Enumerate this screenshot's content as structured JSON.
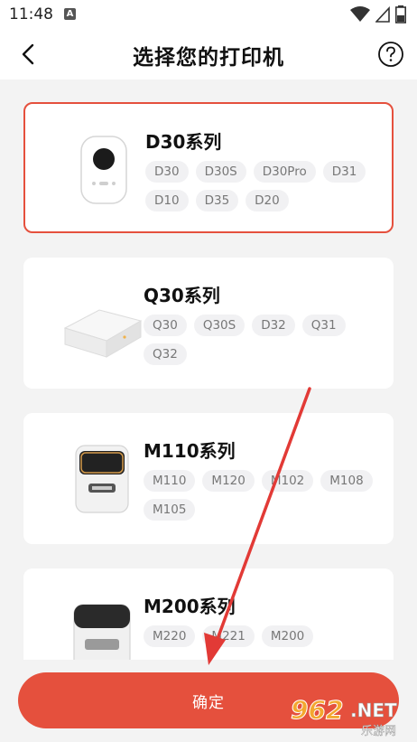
{
  "status_bar": {
    "time": "11:48",
    "notif_badge": "A"
  },
  "header": {
    "title": "选择您的打印机"
  },
  "printers": [
    {
      "series": "D30系列",
      "models": [
        "D30",
        "D30S",
        "D30Pro",
        "D31",
        "D10",
        "D35",
        "D20"
      ],
      "selected": true
    },
    {
      "series": "Q30系列",
      "models": [
        "Q30",
        "Q30S",
        "D32",
        "Q31",
        "Q32"
      ],
      "selected": false
    },
    {
      "series": "M110系列",
      "models": [
        "M110",
        "M120",
        "M102",
        "M108",
        "M105"
      ],
      "selected": false
    },
    {
      "series": "M200系列",
      "models": [
        "M220",
        "M221",
        "M200"
      ],
      "selected": false
    }
  ],
  "confirm_label": "确定",
  "watermark": {
    "number": "962",
    "suffix": ".NET",
    "subtitle": "乐游网"
  },
  "colors": {
    "accent": "#e5503d",
    "chip_bg": "#f1f1f3",
    "background": "#f3f3f3"
  }
}
